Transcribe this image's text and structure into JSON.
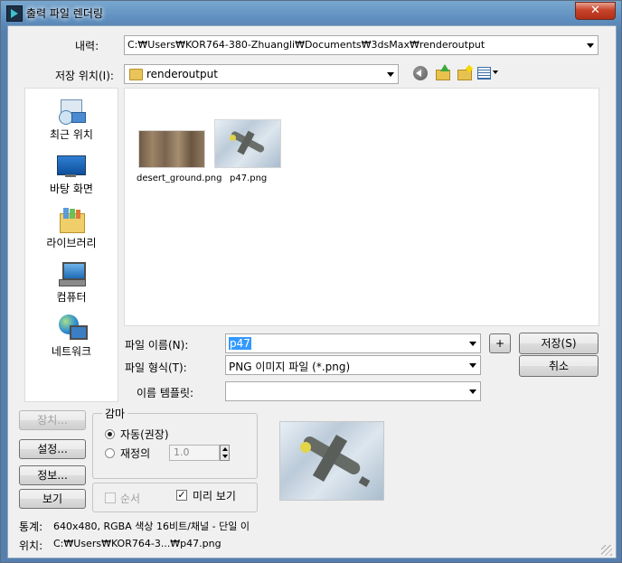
{
  "window": {
    "title": "출력 파일 렌더링",
    "close_glyph": "✕"
  },
  "lookin": {
    "label": "내력:",
    "value": "C:₩Users₩KOR764-380-Zhuangli₩Documents₩3dsMax₩renderoutput"
  },
  "savein": {
    "label": "저장 위치(I):",
    "value": "renderoutput"
  },
  "toolbar": {
    "back_icon": "back-arrow-icon",
    "up_icon": "up-folder-icon",
    "newfolder_icon": "new-folder-icon",
    "views_icon": "view-menu-icon"
  },
  "places": [
    {
      "label": "최근 위치",
      "icon": "recent-places-icon"
    },
    {
      "label": "바탕 화면",
      "icon": "desktop-icon"
    },
    {
      "label": "라이브러리",
      "icon": "libraries-icon"
    },
    {
      "label": "컴퓨터",
      "icon": "computer-icon"
    },
    {
      "label": "네트워크",
      "icon": "network-icon"
    }
  ],
  "files": [
    {
      "name": "desert_ground.png"
    },
    {
      "name": "p47.png"
    }
  ],
  "filename": {
    "label": "파일 이름(N):",
    "value": "p47",
    "plus": "+"
  },
  "filetype": {
    "label": "파일 형식(T):",
    "value": "PNG 이미지 파일 (*.png)"
  },
  "template": {
    "label": "이름 템플릿:",
    "value": ""
  },
  "buttons": {
    "save": "저장(S)",
    "cancel": "취소",
    "devices": "장치...",
    "setup": "설정...",
    "info": "정보...",
    "view": "보기"
  },
  "gamma": {
    "title": "감마",
    "auto": "자동(권장)",
    "override": "재정의",
    "override_value": "1.0"
  },
  "sequence": {
    "label": "순서",
    "checked": false
  },
  "preview": {
    "label": "미리 보기",
    "checked": true
  },
  "stats": {
    "label": "통계:",
    "value": "640x480, RGBA 색상 16비트/채널 - 단일 이"
  },
  "location": {
    "label": "위치:",
    "value": "C:₩Users₩KOR764-3...₩p47.png"
  }
}
